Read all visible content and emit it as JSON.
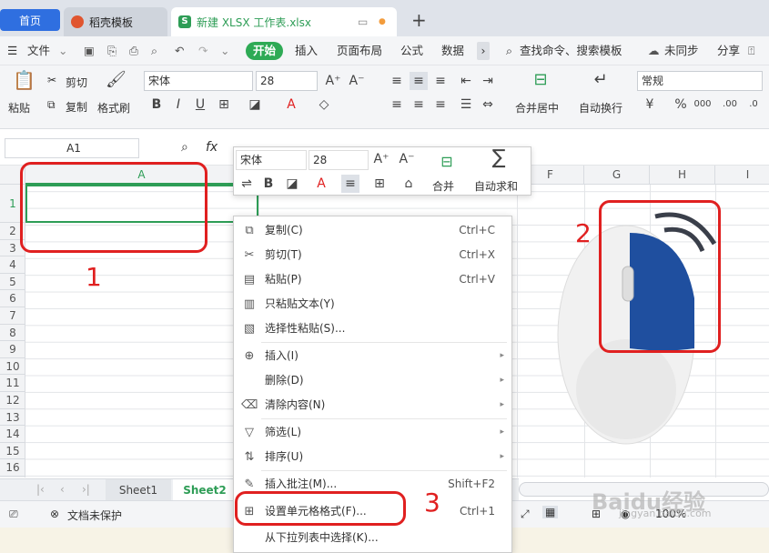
{
  "tabs": {
    "home": "首页",
    "template": "稻壳模板",
    "file": "新建 XLSX 工作表.xlsx",
    "new_tab": "+"
  },
  "menu": {
    "file": "文件",
    "start": "开始",
    "insert": "插入",
    "page_layout": "页面布局",
    "formula": "公式",
    "data": "数据",
    "search": "查找命令、搜索模板",
    "sync": "未同步",
    "share": "分享",
    "more_icon": "›"
  },
  "ribbon": {
    "paste": "粘贴",
    "cut": "剪切",
    "copy": "复制",
    "format_painter": "格式刷",
    "font": "宋体",
    "size": "28",
    "bold": "B",
    "italic": "I",
    "underline": "U",
    "merge": "合并居中",
    "wrap": "自动换行",
    "numfmt": "常规",
    "percent": "%",
    "grow": "A⁺",
    "shrink": "A⁻"
  },
  "formula_bar": {
    "namebox": "A1",
    "fx": "fx"
  },
  "columns": [
    "A",
    "F",
    "G",
    "H",
    "I"
  ],
  "rows": [
    "1",
    "2",
    "3",
    "4",
    "5",
    "6",
    "7",
    "8",
    "9",
    "10",
    "11",
    "12",
    "13",
    "14",
    "15",
    "16"
  ],
  "mini_toolbar": {
    "font": "宋体",
    "size": "28",
    "bold": "B",
    "merge": "合并",
    "autosum": "自动求和"
  },
  "context_menu": [
    {
      "label": "复制(C)",
      "shortcut": "Ctrl+C",
      "icon": "copy-icon"
    },
    {
      "label": "剪切(T)",
      "shortcut": "Ctrl+X",
      "icon": "scissors-icon"
    },
    {
      "label": "粘贴(P)",
      "shortcut": "Ctrl+V",
      "icon": "paste-icon"
    },
    {
      "label": "只粘贴文本(Y)",
      "shortcut": "",
      "icon": "paste-text-icon"
    },
    {
      "label": "选择性粘贴(S)...",
      "shortcut": "",
      "icon": "paste-special-icon"
    },
    {
      "label": "插入(I)",
      "shortcut": "",
      "icon": "insert-icon"
    },
    {
      "label": "删除(D)",
      "shortcut": "",
      "icon": ""
    },
    {
      "label": "清除内容(N)",
      "shortcut": "",
      "icon": "eraser-icon"
    },
    {
      "label": "筛选(L)",
      "shortcut": "",
      "icon": "filter-icon"
    },
    {
      "label": "排序(U)",
      "shortcut": "",
      "icon": "sort-icon"
    },
    {
      "label": "插入批注(M)...",
      "shortcut": "Shift+F2",
      "icon": "comment-icon"
    },
    {
      "label": "设置单元格格式(F)...",
      "shortcut": "Ctrl+1",
      "icon": "format-cells-icon"
    },
    {
      "label": "从下拉列表中选择(K)...",
      "shortcut": "",
      "icon": ""
    }
  ],
  "sheets": [
    "Sheet1",
    "Sheet2"
  ],
  "status": {
    "protect": "文档未保护",
    "zoom": "100%"
  },
  "annotations": [
    "1",
    "2",
    "3"
  ],
  "watermark": "Baidu经验",
  "watermark_sub": "jingyan.baidu.com"
}
